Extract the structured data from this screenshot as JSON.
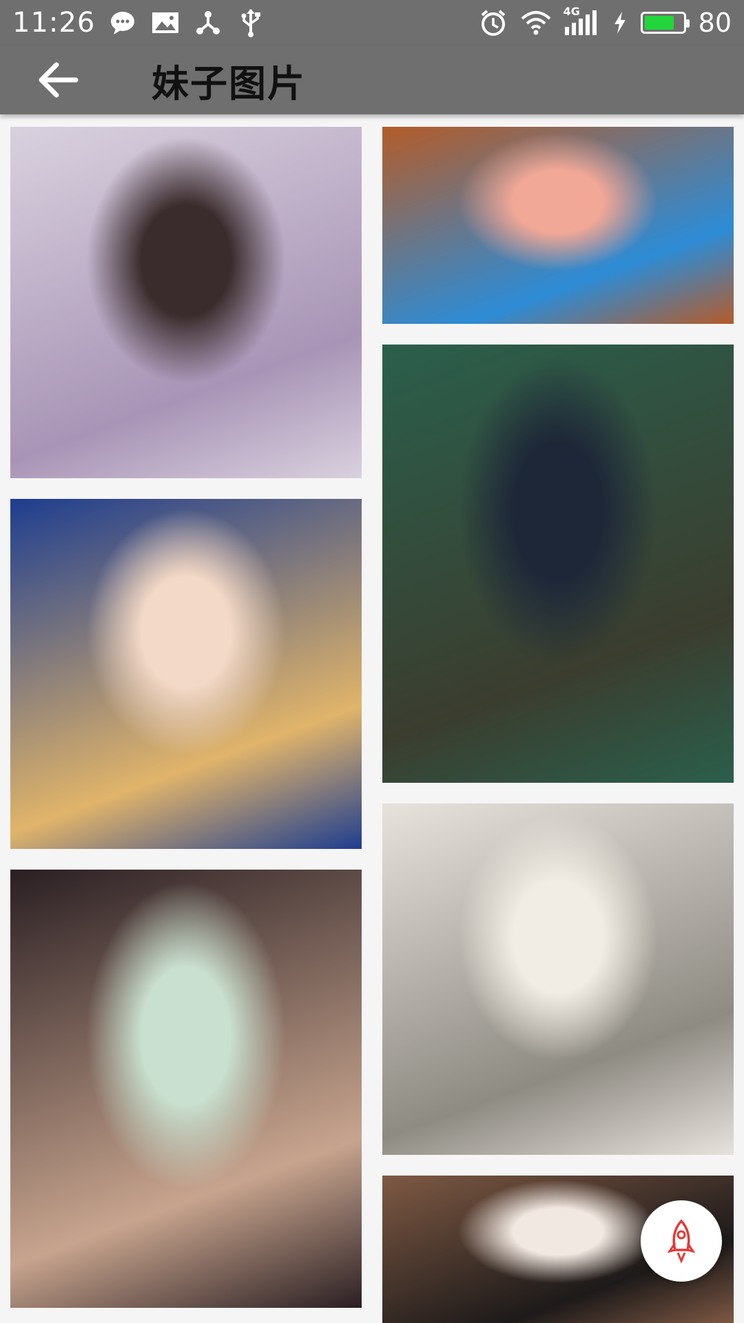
{
  "status_bar": {
    "time": "11:26",
    "network": "4G",
    "battery_level": "80",
    "battery_fraction": 0.8,
    "left_icons": [
      "chat-bubble-icon",
      "image-icon",
      "share-network-icon",
      "usb-icon"
    ],
    "right_icons": [
      "alarm-icon",
      "wifi-icon",
      "signal-icon",
      "charging-icon",
      "battery-icon"
    ]
  },
  "toolbar": {
    "title": "妹子图片",
    "back_icon": "arrow-left-icon"
  },
  "gallery": {
    "photos": [
      {
        "name": "photo-girl-lilac-sweater",
        "colors": [
          "#d9d1de",
          "#a894b6",
          "#3a2c2c"
        ]
      },
      {
        "name": "photo-girl-kimono-fishing-game",
        "colors": [
          "#b45c2a",
          "#2d8cd6",
          "#f2a896"
        ]
      },
      {
        "name": "photo-girl-bear-hood-collage",
        "colors": [
          "#1e3d8f",
          "#e0b46a",
          "#f3d9c7"
        ]
      },
      {
        "name": "photo-girl-trench-coat-phone-booth",
        "colors": [
          "#2b5f4c",
          "#3b3d2f",
          "#1e2738"
        ]
      },
      {
        "name": "photo-girl-cat-whiskers-filter",
        "colors": [
          "#2a1f23",
          "#c7a48e",
          "#c9dfcf"
        ]
      },
      {
        "name": "photo-girl-mask-mirror-selfie",
        "colors": [
          "#e7e2dc",
          "#8e8b83",
          "#f2ede4"
        ]
      },
      {
        "name": "photo-girl-short-hair-lying",
        "colors": [
          "#7e5944",
          "#1d1a1a",
          "#f1e8e2"
        ]
      }
    ]
  },
  "fab": {
    "icon": "rocket-icon",
    "accent": "#e53935"
  }
}
